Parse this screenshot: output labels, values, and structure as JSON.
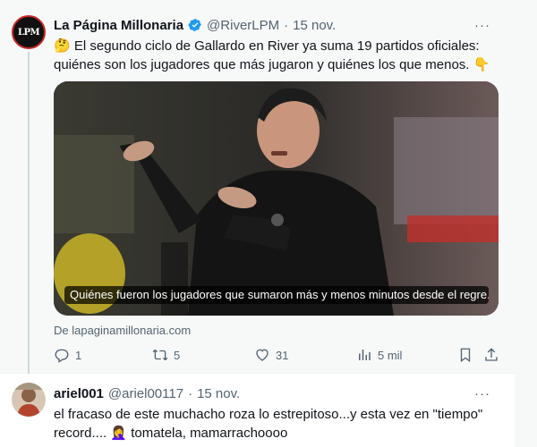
{
  "tweet": {
    "author_name": "La Página Millonaria",
    "handle": "@RiverLPM",
    "separator": "·",
    "date": "15 nov.",
    "more": "···",
    "avatar_text": "LPM",
    "emoji_start": "🤔",
    "text": "El segundo ciclo de Gallardo en River ya suma 19 partidos oficiales: quiénes son los jugadores que más jugaron y quiénes los que menos.",
    "emoji_end": "👇",
    "media_caption": "Quiénes fueron los jugadores que sumaron más y menos minutos desde el regre...",
    "source": "De lapaginamillonaria.com",
    "actions": {
      "replies": "1",
      "retweets": "5",
      "likes": "31",
      "views": "5 mil"
    }
  },
  "reply": {
    "author_name": "ariel001",
    "handle": "@ariel00117",
    "separator": "·",
    "date": "15 nov.",
    "more": "···",
    "text": "el fracaso de este muchacho roza lo estrepitoso...y esta vez en \"tiempo\" record.... 🤦‍♀️ tomatela, mamarrachoooo"
  },
  "colors": {
    "text_primary": "#0f1419",
    "text_secondary": "#536471",
    "verified_blue": "#1d9bf0",
    "thread_line": "#cfd9de",
    "main_bg": "#f7f9f9"
  }
}
